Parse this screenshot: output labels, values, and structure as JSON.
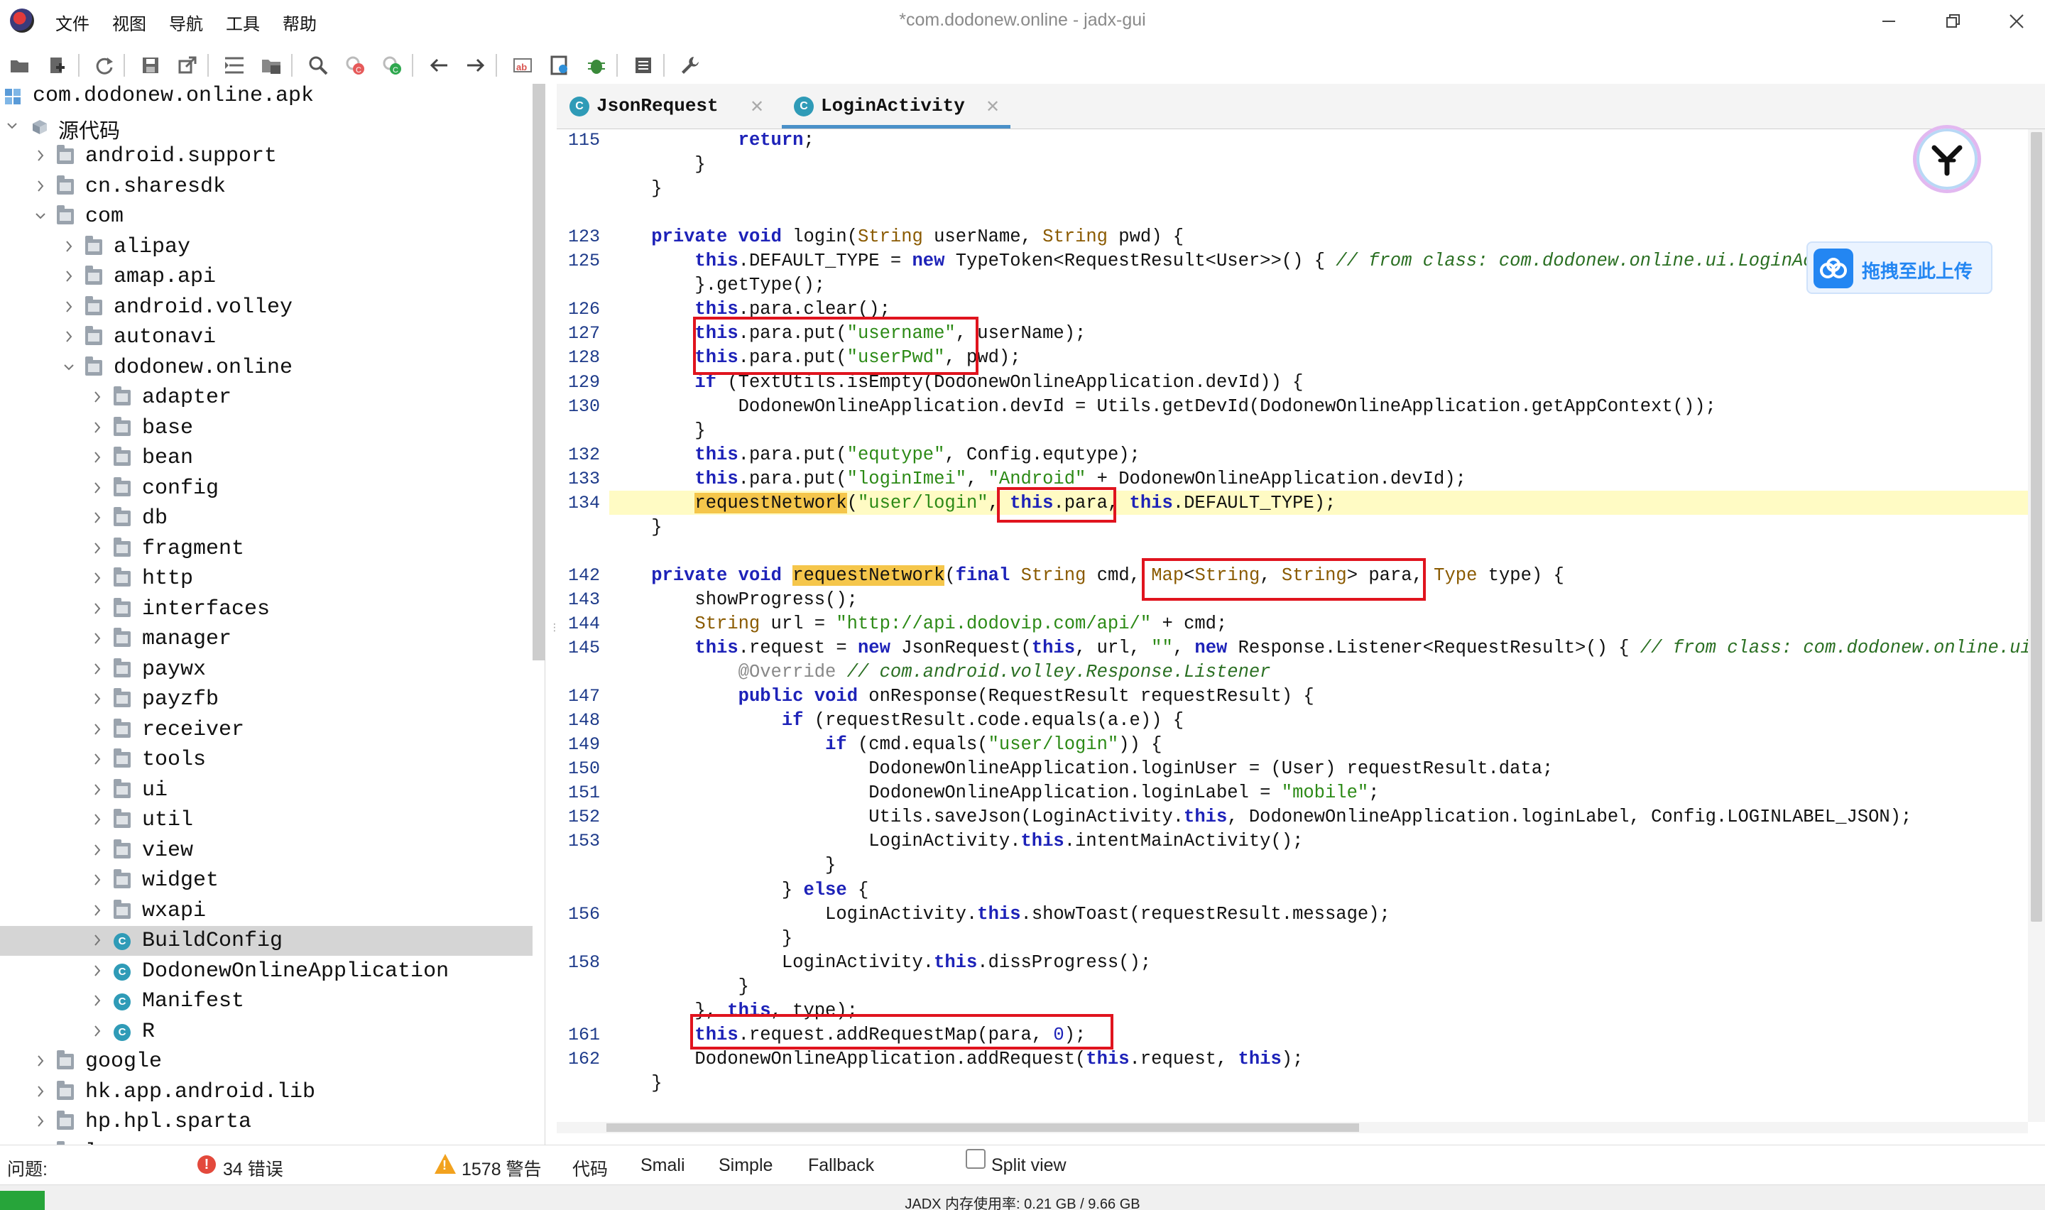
{
  "window": {
    "title": "*com.dodonew.online - jadx-gui",
    "menu": [
      "文件",
      "视图",
      "导航",
      "工具",
      "帮助"
    ]
  },
  "toolbar": {
    "icons": [
      "open-file-icon",
      "add-files-icon",
      "sync-icon",
      "save-icon",
      "export-icon",
      "sync-tree-icon",
      "flatten-packages-icon",
      "search-icon",
      "class-search-icon",
      "usage-search-icon",
      "back-icon",
      "forward-icon",
      "deobfuscation-icon",
      "quark-icon",
      "debug-icon",
      "log-icon",
      "preferences-icon"
    ]
  },
  "tree": {
    "root": "com.dodonew.online.apk",
    "source": "源代码",
    "items": [
      {
        "label": "android.support",
        "kind": "package"
      },
      {
        "label": "cn.sharesdk",
        "kind": "package"
      },
      {
        "label": "com",
        "kind": "package"
      },
      {
        "label": "alipay",
        "kind": "package"
      },
      {
        "label": "amap.api",
        "kind": "package"
      },
      {
        "label": "android.volley",
        "kind": "package"
      },
      {
        "label": "autonavi",
        "kind": "package"
      },
      {
        "label": "dodonew.online",
        "kind": "package"
      },
      {
        "label": "adapter",
        "kind": "package"
      },
      {
        "label": "base",
        "kind": "package"
      },
      {
        "label": "bean",
        "kind": "package"
      },
      {
        "label": "config",
        "kind": "package"
      },
      {
        "label": "db",
        "kind": "package"
      },
      {
        "label": "fragment",
        "kind": "package"
      },
      {
        "label": "http",
        "kind": "package"
      },
      {
        "label": "interfaces",
        "kind": "package"
      },
      {
        "label": "manager",
        "kind": "package"
      },
      {
        "label": "paywx",
        "kind": "package"
      },
      {
        "label": "payzfb",
        "kind": "package"
      },
      {
        "label": "receiver",
        "kind": "package"
      },
      {
        "label": "tools",
        "kind": "package"
      },
      {
        "label": "ui",
        "kind": "package"
      },
      {
        "label": "util",
        "kind": "package"
      },
      {
        "label": "view",
        "kind": "package"
      },
      {
        "label": "widget",
        "kind": "package"
      },
      {
        "label": "wxapi",
        "kind": "package"
      },
      {
        "label": "BuildConfig",
        "kind": "class",
        "selected": true
      },
      {
        "label": "DodonewOnlineApplication",
        "kind": "class"
      },
      {
        "label": "Manifest",
        "kind": "class"
      },
      {
        "label": "R",
        "kind": "class"
      },
      {
        "label": "google",
        "kind": "package"
      },
      {
        "label": "hk.app.android.lib",
        "kind": "package"
      },
      {
        "label": "hp.hpl.sparta",
        "kind": "package"
      },
      {
        "label": "loc",
        "kind": "package"
      }
    ]
  },
  "tabs": [
    {
      "label": "JsonRequest",
      "active": false
    },
    {
      "label": "LoginActivity",
      "active": true
    }
  ],
  "code": {
    "lines": [
      {
        "n": "115",
        "t": "            return;"
      },
      {
        "n": "",
        "t": "        }"
      },
      {
        "n": "",
        "t": "    }"
      },
      {
        "n": "",
        "t": ""
      },
      {
        "n": "123",
        "t": "    private void login(String userName, String pwd) {"
      },
      {
        "n": "125",
        "t": "        this.DEFAULT_TYPE = new TypeToken<RequestResult<User>>() { // from class: com.dodonew.online.ui.LoginAc"
      },
      {
        "n": "",
        "t": "        }.getType();"
      },
      {
        "n": "126",
        "t": "        this.para.clear();"
      },
      {
        "n": "127",
        "t": "        this.para.put(\"username\", userName);"
      },
      {
        "n": "128",
        "t": "        this.para.put(\"userPwd\", pwd);"
      },
      {
        "n": "129",
        "t": "        if (TextUtils.isEmpty(DodonewOnlineApplication.devId)) {"
      },
      {
        "n": "130",
        "t": "            DodonewOnlineApplication.devId = Utils.getDevId(DodonewOnlineApplication.getAppContext());"
      },
      {
        "n": "",
        "t": "        }"
      },
      {
        "n": "132",
        "t": "        this.para.put(\"equtype\", Config.equtype);"
      },
      {
        "n": "133",
        "t": "        this.para.put(\"loginImei\", \"Android\" + DodonewOnlineApplication.devId);"
      },
      {
        "n": "134",
        "t": "        requestNetwork(\"user/login\", this.para, this.DEFAULT_TYPE);"
      },
      {
        "n": "",
        "t": "    }"
      },
      {
        "n": "",
        "t": ""
      },
      {
        "n": "142",
        "t": "    private void requestNetwork(final String cmd, Map<String, String> para, Type type) {"
      },
      {
        "n": "143",
        "t": "        showProgress();"
      },
      {
        "n": "144",
        "t": "        String url = \"http://api.dodovip.com/api/\" + cmd;"
      },
      {
        "n": "145",
        "t": "        this.request = new JsonRequest(this, url, \"\", new Response.Listener<RequestResult>() { // from class: com.dodonew.online.ui"
      },
      {
        "n": "",
        "t": "            @Override // com.android.volley.Response.Listener"
      },
      {
        "n": "147",
        "t": "            public void onResponse(RequestResult requestResult) {"
      },
      {
        "n": "148",
        "t": "                if (requestResult.code.equals(a.e)) {"
      },
      {
        "n": "149",
        "t": "                    if (cmd.equals(\"user/login\")) {"
      },
      {
        "n": "150",
        "t": "                        DodonewOnlineApplication.loginUser = (User) requestResult.data;"
      },
      {
        "n": "151",
        "t": "                        DodonewOnlineApplication.loginLabel = \"mobile\";"
      },
      {
        "n": "152",
        "t": "                        Utils.saveJson(LoginActivity.this, DodonewOnlineApplication.loginLabel, Config.LOGINLABEL_JSON);"
      },
      {
        "n": "153",
        "t": "                        LoginActivity.this.intentMainActivity();"
      },
      {
        "n": "",
        "t": "                    }"
      },
      {
        "n": "",
        "t": "                } else {"
      },
      {
        "n": "156",
        "t": "                    LoginActivity.this.showToast(requestResult.message);"
      },
      {
        "n": "",
        "t": "                }"
      },
      {
        "n": "158",
        "t": "                LoginActivity.this.dissProgress();"
      },
      {
        "n": "",
        "t": "            }"
      },
      {
        "n": "",
        "t": "        }, this, type);"
      },
      {
        "n": "161",
        "t": "        this.request.addRequestMap(para, 0);"
      },
      {
        "n": "162",
        "t": "        DodonewOnlineApplication.addRequest(this.request, this);"
      },
      {
        "n": "",
        "t": "    }"
      }
    ],
    "highlight_line": "134"
  },
  "upload_widget": {
    "label": "拖拽至此上传"
  },
  "bottom": {
    "problems_label": "问题:",
    "errors": "34 错误",
    "warnings": "1578 警告",
    "view_tabs": [
      "代码",
      "Smali",
      "Simple",
      "Fallback"
    ],
    "split_view": "Split view"
  },
  "status": {
    "memory": "JADX 内存使用率:  0.21 GB / 9.66 GB",
    "memory_fraction": 0.022
  },
  "colors": {
    "keyword": "#1d22b8",
    "string": "#2c8a16",
    "comment": "#2a6f22",
    "type": "#8a5a00",
    "highlight": "#fffbc4",
    "mark": "#f5c64b",
    "annotation_box": "#e0141e",
    "memory_bar": "#27a53a"
  }
}
